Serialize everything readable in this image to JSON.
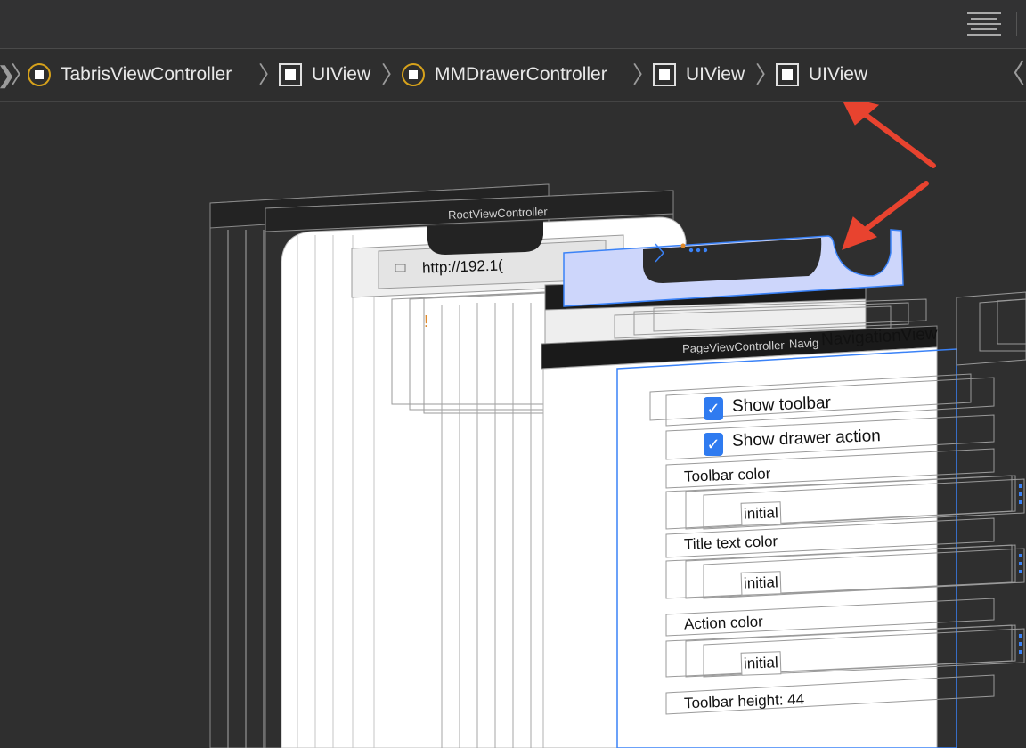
{
  "breadcrumbs": [
    {
      "label": "TabrisViewController",
      "kind": "view-controller"
    },
    {
      "label": "UIView",
      "kind": "view"
    },
    {
      "label": "MMDrawerController",
      "kind": "view-controller"
    },
    {
      "label": "UIView",
      "kind": "view"
    },
    {
      "label": "UIView",
      "kind": "view"
    }
  ],
  "canvas": {
    "root_controller_label": "RootViewController",
    "url_text": "http://192.1(",
    "warning_mark": "!",
    "page_controller_label": "PageViewController",
    "navig_label": "Navig",
    "navigation_view_label": "NavigationView",
    "show_toolbar": "Show toolbar",
    "show_drawer_action": "Show drawer action",
    "toolbar_color": "Toolbar color",
    "toolbar_color_value": "initial",
    "title_text_color": "Title text color",
    "title_text_color_value": "initial",
    "action_color": "Action color",
    "action_color_value": "initial",
    "toolbar_height": "Toolbar height: 44"
  },
  "colors": {
    "annotation_arrow": "#e8432f",
    "selection_blue": "#3a82f7",
    "selection_fill": "#cdd6fb",
    "vc_icon_ring": "#d7a21b"
  }
}
